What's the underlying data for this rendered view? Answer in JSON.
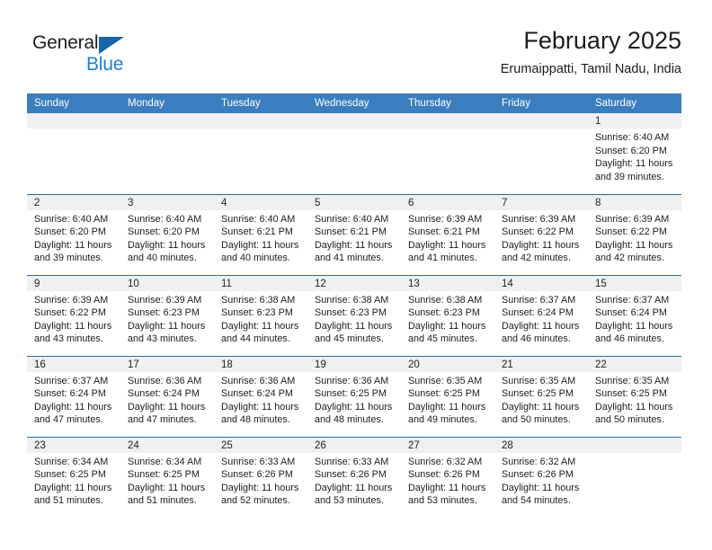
{
  "brand": {
    "name_top": "General",
    "name_bottom": "Blue",
    "accent_color": "#1f7fd0",
    "triangle_color": "#1565a8"
  },
  "header": {
    "month_title": "February 2025",
    "location": "Erumaippatti, Tamil Nadu, India"
  },
  "calendar": {
    "header_bg": "#3a7ebf",
    "daynum_band_bg": "#f0f0f0",
    "week_border_color": "#2e6da4",
    "weekdays": [
      "Sunday",
      "Monday",
      "Tuesday",
      "Wednesday",
      "Thursday",
      "Friday",
      "Saturday"
    ],
    "weeks": [
      [
        {
          "day": "",
          "sunrise": "",
          "sunset": "",
          "daylight_line1": "",
          "daylight_line2": "",
          "empty": true
        },
        {
          "day": "",
          "sunrise": "",
          "sunset": "",
          "daylight_line1": "",
          "daylight_line2": "",
          "empty": true
        },
        {
          "day": "",
          "sunrise": "",
          "sunset": "",
          "daylight_line1": "",
          "daylight_line2": "",
          "empty": true
        },
        {
          "day": "",
          "sunrise": "",
          "sunset": "",
          "daylight_line1": "",
          "daylight_line2": "",
          "empty": true
        },
        {
          "day": "",
          "sunrise": "",
          "sunset": "",
          "daylight_line1": "",
          "daylight_line2": "",
          "empty": true
        },
        {
          "day": "",
          "sunrise": "",
          "sunset": "",
          "daylight_line1": "",
          "daylight_line2": "",
          "empty": true
        },
        {
          "day": "1",
          "sunrise": "Sunrise: 6:40 AM",
          "sunset": "Sunset: 6:20 PM",
          "daylight_line1": "Daylight: 11 hours",
          "daylight_line2": "and 39 minutes.",
          "empty": false
        }
      ],
      [
        {
          "day": "2",
          "sunrise": "Sunrise: 6:40 AM",
          "sunset": "Sunset: 6:20 PM",
          "daylight_line1": "Daylight: 11 hours",
          "daylight_line2": "and 39 minutes.",
          "empty": false
        },
        {
          "day": "3",
          "sunrise": "Sunrise: 6:40 AM",
          "sunset": "Sunset: 6:20 PM",
          "daylight_line1": "Daylight: 11 hours",
          "daylight_line2": "and 40 minutes.",
          "empty": false
        },
        {
          "day": "4",
          "sunrise": "Sunrise: 6:40 AM",
          "sunset": "Sunset: 6:21 PM",
          "daylight_line1": "Daylight: 11 hours",
          "daylight_line2": "and 40 minutes.",
          "empty": false
        },
        {
          "day": "5",
          "sunrise": "Sunrise: 6:40 AM",
          "sunset": "Sunset: 6:21 PM",
          "daylight_line1": "Daylight: 11 hours",
          "daylight_line2": "and 41 minutes.",
          "empty": false
        },
        {
          "day": "6",
          "sunrise": "Sunrise: 6:39 AM",
          "sunset": "Sunset: 6:21 PM",
          "daylight_line1": "Daylight: 11 hours",
          "daylight_line2": "and 41 minutes.",
          "empty": false
        },
        {
          "day": "7",
          "sunrise": "Sunrise: 6:39 AM",
          "sunset": "Sunset: 6:22 PM",
          "daylight_line1": "Daylight: 11 hours",
          "daylight_line2": "and 42 minutes.",
          "empty": false
        },
        {
          "day": "8",
          "sunrise": "Sunrise: 6:39 AM",
          "sunset": "Sunset: 6:22 PM",
          "daylight_line1": "Daylight: 11 hours",
          "daylight_line2": "and 42 minutes.",
          "empty": false
        }
      ],
      [
        {
          "day": "9",
          "sunrise": "Sunrise: 6:39 AM",
          "sunset": "Sunset: 6:22 PM",
          "daylight_line1": "Daylight: 11 hours",
          "daylight_line2": "and 43 minutes.",
          "empty": false
        },
        {
          "day": "10",
          "sunrise": "Sunrise: 6:39 AM",
          "sunset": "Sunset: 6:23 PM",
          "daylight_line1": "Daylight: 11 hours",
          "daylight_line2": "and 43 minutes.",
          "empty": false
        },
        {
          "day": "11",
          "sunrise": "Sunrise: 6:38 AM",
          "sunset": "Sunset: 6:23 PM",
          "daylight_line1": "Daylight: 11 hours",
          "daylight_line2": "and 44 minutes.",
          "empty": false
        },
        {
          "day": "12",
          "sunrise": "Sunrise: 6:38 AM",
          "sunset": "Sunset: 6:23 PM",
          "daylight_line1": "Daylight: 11 hours",
          "daylight_line2": "and 45 minutes.",
          "empty": false
        },
        {
          "day": "13",
          "sunrise": "Sunrise: 6:38 AM",
          "sunset": "Sunset: 6:23 PM",
          "daylight_line1": "Daylight: 11 hours",
          "daylight_line2": "and 45 minutes.",
          "empty": false
        },
        {
          "day": "14",
          "sunrise": "Sunrise: 6:37 AM",
          "sunset": "Sunset: 6:24 PM",
          "daylight_line1": "Daylight: 11 hours",
          "daylight_line2": "and 46 minutes.",
          "empty": false
        },
        {
          "day": "15",
          "sunrise": "Sunrise: 6:37 AM",
          "sunset": "Sunset: 6:24 PM",
          "daylight_line1": "Daylight: 11 hours",
          "daylight_line2": "and 46 minutes.",
          "empty": false
        }
      ],
      [
        {
          "day": "16",
          "sunrise": "Sunrise: 6:37 AM",
          "sunset": "Sunset: 6:24 PM",
          "daylight_line1": "Daylight: 11 hours",
          "daylight_line2": "and 47 minutes.",
          "empty": false
        },
        {
          "day": "17",
          "sunrise": "Sunrise: 6:36 AM",
          "sunset": "Sunset: 6:24 PM",
          "daylight_line1": "Daylight: 11 hours",
          "daylight_line2": "and 47 minutes.",
          "empty": false
        },
        {
          "day": "18",
          "sunrise": "Sunrise: 6:36 AM",
          "sunset": "Sunset: 6:24 PM",
          "daylight_line1": "Daylight: 11 hours",
          "daylight_line2": "and 48 minutes.",
          "empty": false
        },
        {
          "day": "19",
          "sunrise": "Sunrise: 6:36 AM",
          "sunset": "Sunset: 6:25 PM",
          "daylight_line1": "Daylight: 11 hours",
          "daylight_line2": "and 48 minutes.",
          "empty": false
        },
        {
          "day": "20",
          "sunrise": "Sunrise: 6:35 AM",
          "sunset": "Sunset: 6:25 PM",
          "daylight_line1": "Daylight: 11 hours",
          "daylight_line2": "and 49 minutes.",
          "empty": false
        },
        {
          "day": "21",
          "sunrise": "Sunrise: 6:35 AM",
          "sunset": "Sunset: 6:25 PM",
          "daylight_line1": "Daylight: 11 hours",
          "daylight_line2": "and 50 minutes.",
          "empty": false
        },
        {
          "day": "22",
          "sunrise": "Sunrise: 6:35 AM",
          "sunset": "Sunset: 6:25 PM",
          "daylight_line1": "Daylight: 11 hours",
          "daylight_line2": "and 50 minutes.",
          "empty": false
        }
      ],
      [
        {
          "day": "23",
          "sunrise": "Sunrise: 6:34 AM",
          "sunset": "Sunset: 6:25 PM",
          "daylight_line1": "Daylight: 11 hours",
          "daylight_line2": "and 51 minutes.",
          "empty": false
        },
        {
          "day": "24",
          "sunrise": "Sunrise: 6:34 AM",
          "sunset": "Sunset: 6:25 PM",
          "daylight_line1": "Daylight: 11 hours",
          "daylight_line2": "and 51 minutes.",
          "empty": false
        },
        {
          "day": "25",
          "sunrise": "Sunrise: 6:33 AM",
          "sunset": "Sunset: 6:26 PM",
          "daylight_line1": "Daylight: 11 hours",
          "daylight_line2": "and 52 minutes.",
          "empty": false
        },
        {
          "day": "26",
          "sunrise": "Sunrise: 6:33 AM",
          "sunset": "Sunset: 6:26 PM",
          "daylight_line1": "Daylight: 11 hours",
          "daylight_line2": "and 53 minutes.",
          "empty": false
        },
        {
          "day": "27",
          "sunrise": "Sunrise: 6:32 AM",
          "sunset": "Sunset: 6:26 PM",
          "daylight_line1": "Daylight: 11 hours",
          "daylight_line2": "and 53 minutes.",
          "empty": false
        },
        {
          "day": "28",
          "sunrise": "Sunrise: 6:32 AM",
          "sunset": "Sunset: 6:26 PM",
          "daylight_line1": "Daylight: 11 hours",
          "daylight_line2": "and 54 minutes.",
          "empty": false
        },
        {
          "day": "",
          "sunrise": "",
          "sunset": "",
          "daylight_line1": "",
          "daylight_line2": "",
          "empty": true
        }
      ]
    ]
  }
}
